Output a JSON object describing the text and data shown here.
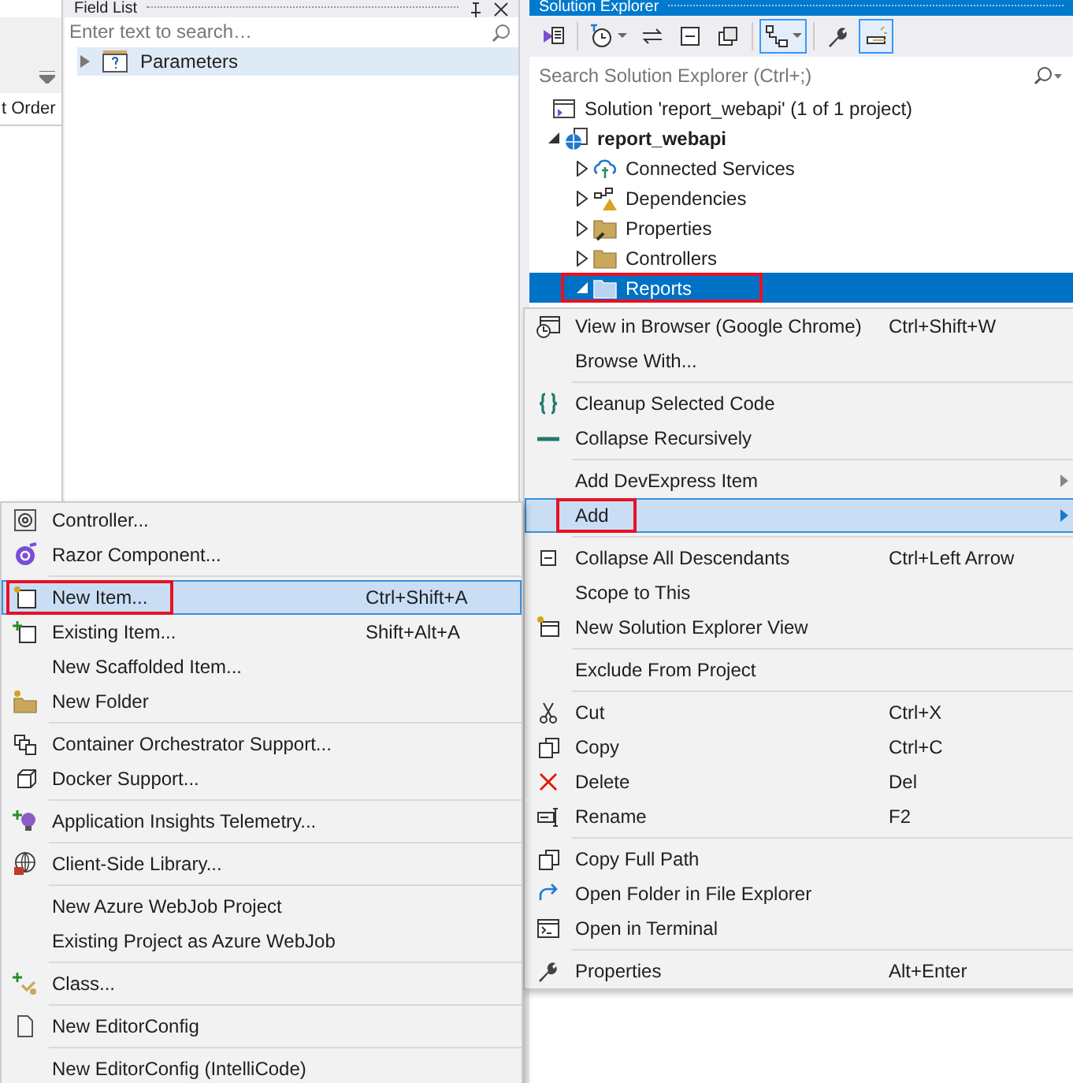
{
  "left_panel": {
    "column_header": "t Order"
  },
  "field_list": {
    "title": "Field List",
    "search": {
      "placeholder": "Enter text to search…"
    },
    "tree": [
      {
        "label": "Parameters",
        "expanded": false,
        "selected": true
      }
    ]
  },
  "solution_explorer": {
    "title": "Solution Explorer",
    "toolbar": [
      {
        "pressed": false
      },
      {
        "pressed": false
      },
      {
        "pressed": false
      },
      {
        "pressed": false
      },
      {
        "pressed": false
      },
      {
        "pressed": true
      },
      {
        "pressed": false
      },
      {
        "pressed": true
      }
    ],
    "search": {
      "placeholder": "Search Solution Explorer (Ctrl+;)"
    },
    "solution": "Solution 'report_webapi' (1 of 1 project)",
    "tree": [
      {
        "label": "report_webapi",
        "kind": "project",
        "expanded": true,
        "selected": false,
        "outlined": false,
        "children": [
          {
            "label": "Connected Services",
            "kind": "item",
            "expanded": false,
            "selected": false,
            "outlined": false
          },
          {
            "label": "Dependencies",
            "kind": "item",
            "expanded": false,
            "selected": false,
            "outlined": false
          },
          {
            "label": "Properties",
            "kind": "item",
            "expanded": false,
            "selected": false,
            "outlined": false
          },
          {
            "label": "Controllers",
            "kind": "item",
            "expanded": false,
            "selected": false,
            "outlined": false
          },
          {
            "label": "Reports",
            "kind": "item",
            "expanded": true,
            "selected": true,
            "outlined": true
          }
        ]
      }
    ]
  },
  "context_menu": {
    "groups": [
      [
        {
          "label": "View in Browser (Google Chrome)",
          "shortcut": "Ctrl+Shift+W",
          "submenu": false,
          "selected": false,
          "outlined": false
        },
        {
          "label": "Browse With...",
          "submenu": false,
          "selected": false,
          "outlined": false
        }
      ],
      [
        {
          "label": "Cleanup Selected Code",
          "submenu": false,
          "selected": false,
          "outlined": false
        },
        {
          "label": "Collapse Recursively",
          "submenu": false,
          "selected": false,
          "outlined": false
        }
      ],
      [
        {
          "label": "Add DevExpress Item",
          "submenu": true,
          "selected": false,
          "outlined": false
        },
        {
          "label": "Add",
          "submenu": true,
          "selected": true,
          "outlined": true
        }
      ],
      [
        {
          "label": "Collapse All Descendants",
          "shortcut": "Ctrl+Left Arrow",
          "submenu": false,
          "selected": false,
          "outlined": false
        },
        {
          "label": "Scope to This",
          "submenu": false,
          "selected": false,
          "outlined": false
        },
        {
          "label": "New Solution Explorer View",
          "submenu": false,
          "selected": false,
          "outlined": false
        }
      ],
      [
        {
          "label": "Exclude From Project",
          "submenu": false,
          "selected": false,
          "outlined": false
        }
      ],
      [
        {
          "label": "Cut",
          "shortcut": "Ctrl+X",
          "submenu": false,
          "selected": false,
          "outlined": false
        },
        {
          "label": "Copy",
          "shortcut": "Ctrl+C",
          "submenu": false,
          "selected": false,
          "outlined": false
        },
        {
          "label": "Delete",
          "shortcut": "Del",
          "submenu": false,
          "selected": false,
          "outlined": false
        },
        {
          "label": "Rename",
          "shortcut": "F2",
          "submenu": false,
          "selected": false,
          "outlined": false
        }
      ],
      [
        {
          "label": "Copy Full Path",
          "submenu": false,
          "selected": false,
          "outlined": false
        },
        {
          "label": "Open Folder in File Explorer",
          "submenu": false,
          "selected": false,
          "outlined": false
        },
        {
          "label": "Open in Terminal",
          "submenu": false,
          "selected": false,
          "outlined": false
        }
      ],
      [
        {
          "label": "Properties",
          "shortcut": "Alt+Enter",
          "submenu": false,
          "selected": false,
          "outlined": false
        }
      ]
    ]
  },
  "add_submenu": {
    "groups": [
      [
        {
          "label": "Controller...",
          "selected": false,
          "outlined": false
        },
        {
          "label": "Razor Component...",
          "selected": false,
          "outlined": false
        }
      ],
      [
        {
          "label": "New Item...",
          "shortcut": "Ctrl+Shift+A",
          "selected": true,
          "outlined": true
        },
        {
          "label": "Existing Item...",
          "shortcut": "Shift+Alt+A",
          "selected": false,
          "outlined": false
        },
        {
          "label": "New Scaffolded Item...",
          "selected": false,
          "outlined": false
        },
        {
          "label": "New Folder",
          "selected": false,
          "outlined": false
        }
      ],
      [
        {
          "label": "Container Orchestrator Support...",
          "selected": false,
          "outlined": false
        },
        {
          "label": "Docker Support...",
          "selected": false,
          "outlined": false
        }
      ],
      [
        {
          "label": "Application Insights Telemetry...",
          "selected": false,
          "outlined": false
        }
      ],
      [
        {
          "label": "Client-Side Library...",
          "selected": false,
          "outlined": false
        }
      ],
      [
        {
          "label": "New Azure WebJob Project",
          "selected": false,
          "outlined": false
        },
        {
          "label": "Existing Project as Azure WebJob",
          "selected": false,
          "outlined": false
        }
      ],
      [
        {
          "label": "Class...",
          "selected": false,
          "outlined": false
        }
      ],
      [
        {
          "label": "New EditorConfig",
          "selected": false,
          "outlined": false
        }
      ],
      [
        {
          "label": "New EditorConfig (IntelliCode)",
          "selected": false,
          "outlined": false
        }
      ]
    ]
  }
}
